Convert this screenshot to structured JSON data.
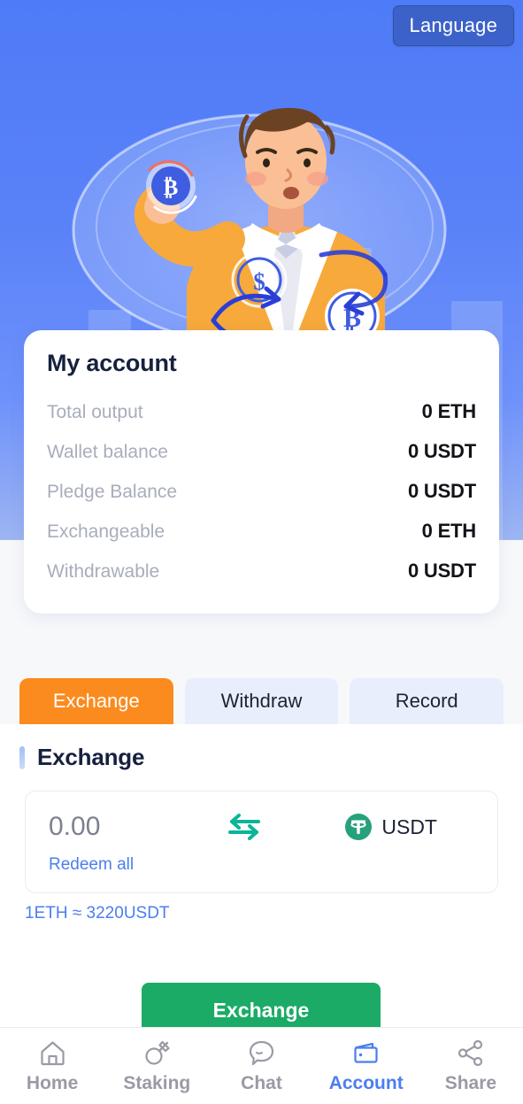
{
  "header": {
    "language_button": "Language",
    "language_icon": "globe-icon"
  },
  "hero": {
    "illustration": "man-holding-bitcoin-illustration",
    "background_color": "#5a82f8"
  },
  "account_card": {
    "title": "My account",
    "rows": [
      {
        "label": "Total output",
        "value": "0 ETH"
      },
      {
        "label": "Wallet balance",
        "value": "0 USDT"
      },
      {
        "label": "Pledge Balance",
        "value": "0 USDT"
      },
      {
        "label": "Exchangeable",
        "value": "0 ETH"
      },
      {
        "label": "Withdrawable",
        "value": "0 USDT"
      }
    ]
  },
  "tabs": [
    {
      "label": "Exchange",
      "active": true
    },
    {
      "label": "Withdraw",
      "active": false
    },
    {
      "label": "Record",
      "active": false
    }
  ],
  "exchange_panel": {
    "title": "Exchange",
    "amount_value": "",
    "amount_placeholder": "0.00",
    "swap_icon": "swap-arrows-icon",
    "coin_symbol": "USDT",
    "coin_logo": "tether-icon",
    "redeem_all_label": "Redeem all",
    "rate_text": "1ETH ≈ 3220USDT",
    "submit_label": "Exchange",
    "accent_color": "#fb8b1e",
    "submit_color": "#1bab66"
  },
  "bottom_nav": [
    {
      "label": "Home",
      "icon": "home-icon",
      "active": false
    },
    {
      "label": "Staking",
      "icon": "pickaxe-icon",
      "active": false
    },
    {
      "label": "Chat",
      "icon": "chat-bubble-icon",
      "active": false
    },
    {
      "label": "Account",
      "icon": "wallet-icon",
      "active": true
    },
    {
      "label": "Share",
      "icon": "share-icon",
      "active": false
    }
  ]
}
